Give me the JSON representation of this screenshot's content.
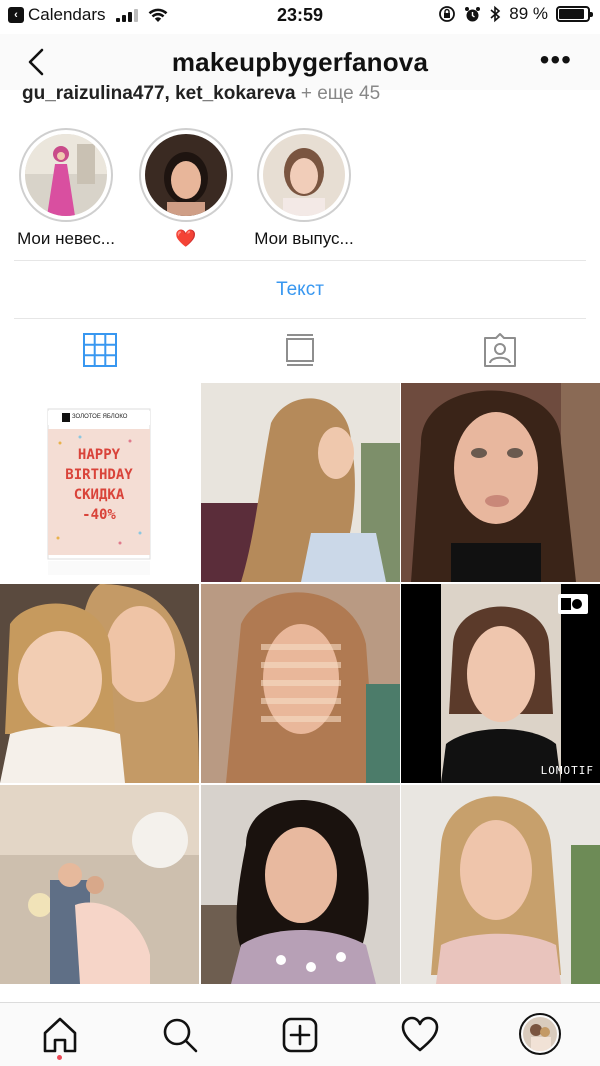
{
  "status_bar": {
    "back_app": "Calendars",
    "time": "23:59",
    "battery_percent": "89 %",
    "battery_level": 0.89
  },
  "header": {
    "title": "makeupbygerfanova",
    "followed_by_text": "gu_raizulina477, ket_kokareva",
    "followed_by_more": " + еще 45"
  },
  "highlights": [
    {
      "label": "Мои невес...",
      "icon": "bride-photo"
    },
    {
      "label": "❤️",
      "icon": "heart-emoji"
    },
    {
      "label": "Мои выпус...",
      "icon": "graduate-photo"
    }
  ],
  "text_button": "Текст",
  "tabs": [
    {
      "name": "grid",
      "icon": "grid-icon",
      "active": true
    },
    {
      "name": "feed",
      "icon": "feed-icon",
      "active": false
    },
    {
      "name": "tagged",
      "icon": "tagged-icon",
      "active": false
    }
  ],
  "posts": [
    {
      "kind": "promo",
      "brand": "ЗОЛОТОЕ ЯБЛОКО",
      "promo_lines": [
        "HAPPY",
        "BIRTHDAY",
        "СКИДКА",
        "-40%"
      ]
    },
    {
      "kind": "photo",
      "desc": "braided hair"
    },
    {
      "kind": "photo",
      "desc": "portrait"
    },
    {
      "kind": "photo",
      "desc": "selfie with child"
    },
    {
      "kind": "photo",
      "desc": "striped light portrait"
    },
    {
      "kind": "video",
      "watermark": "LOMOTIF"
    },
    {
      "kind": "photo",
      "desc": "family with balloons"
    },
    {
      "kind": "photo",
      "desc": "curly hair portrait"
    },
    {
      "kind": "photo",
      "desc": "blonde portrait"
    }
  ],
  "accent_color": "#3897f0",
  "notification_color": "#ed4956"
}
